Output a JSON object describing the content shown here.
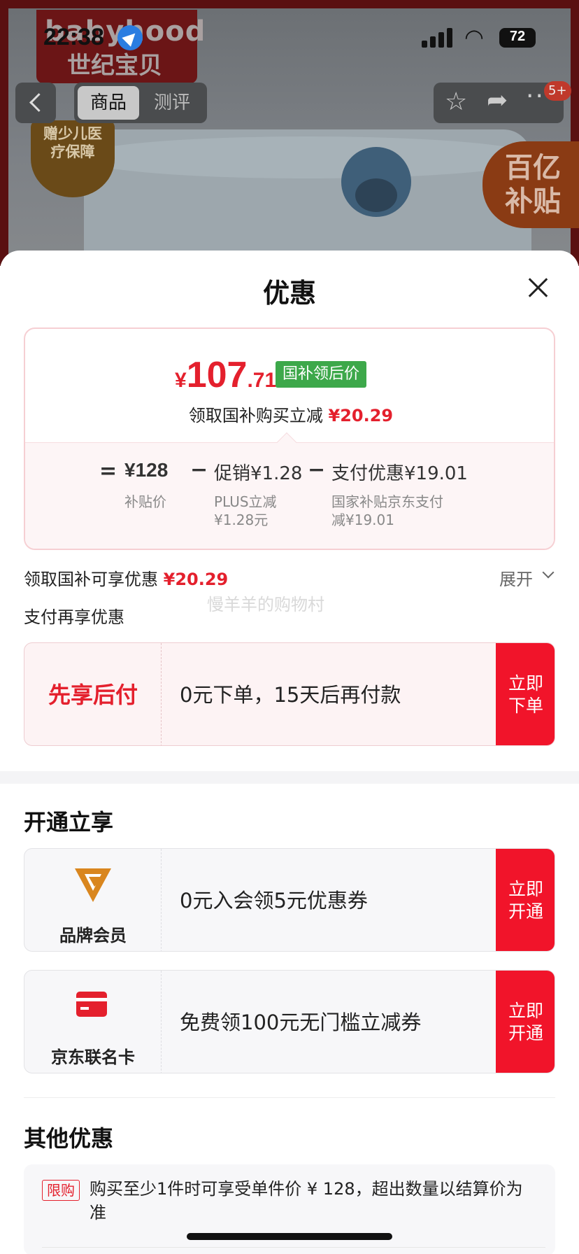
{
  "status_bar": {
    "time": "22:38",
    "battery": "72"
  },
  "background": {
    "brand_en": "babyhood",
    "brand_cn": "世纪宝贝",
    "badge_text": "赠少儿医疗保障",
    "subsidy_text": "百亿补贴"
  },
  "nav": {
    "tabs": [
      {
        "label": "商品"
      },
      {
        "label": "测评"
      }
    ],
    "notification_badge": "5+"
  },
  "sheet": {
    "title": "优惠",
    "price": {
      "currency": "¥",
      "integer": "107",
      "decimal": ".71",
      "tag": "国补领后价",
      "subtitle_prefix": "领取国补购买立减",
      "subtitle_amount": "¥20.29"
    },
    "breakdown": {
      "equals": "=",
      "base_price": "¥128",
      "base_label": "补贴价",
      "minus1": "−",
      "promo": "促销¥1.28",
      "promo_note_line1": "PLUS立减",
      "promo_note_line2": "¥1.28元",
      "minus2": "−",
      "pay_discount": "支付优惠¥19.01",
      "pay_note_line1": "国家补贴京东支付",
      "pay_note_line2": "减¥19.01"
    },
    "promo_line": {
      "label": "领取国补可享优惠",
      "amount": "¥20.29"
    },
    "expand_label": "展开",
    "watermark": "慢羊羊的购物村",
    "pay_again_label": "支付再享优惠",
    "afterpay": {
      "label": "先享后付",
      "desc": "0元下单，15天后再付款",
      "button": "立即下单"
    },
    "open_section": {
      "title": "开通立享",
      "items": [
        {
          "label": "品牌会员",
          "desc": "0元入会领5元优惠券",
          "button": "立即开通"
        },
        {
          "label": "京东联名卡",
          "desc": "免费领100元无门槛立减券",
          "button": "立即开通"
        }
      ]
    },
    "other_section": {
      "title": "其他优惠",
      "limit_tag": "限购",
      "limit_text": "购买至少1件时可享受单件价 ¥ 128，超出数量以结算价为准"
    }
  },
  "colors": {
    "accent_red": "#e4202d",
    "button_red": "#f1142a",
    "tag_green": "#3da84a"
  }
}
